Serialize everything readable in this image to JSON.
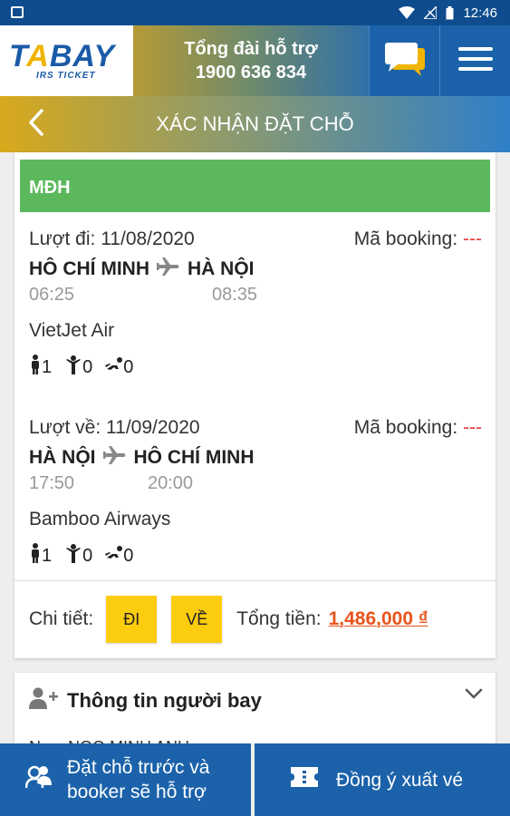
{
  "status_bar": {
    "time": "12:46"
  },
  "header": {
    "logo_main_left": "T",
    "logo_main_a": "A",
    "logo_main_right": "BAY",
    "logo_sub": "IRS TICKET",
    "hotline_label": "Tổng đài hỗ trợ",
    "hotline_number": "1900 636 834"
  },
  "nav": {
    "title": "XÁC NHẬN ĐẶT CHỖ"
  },
  "booking": {
    "header": "MĐH",
    "outbound": {
      "label": "Lượt đi: 11/08/2020",
      "booking_label": "Mã booking:",
      "booking_value": "---",
      "from": "HÔ CHÍ MINH",
      "to": "HÀ NỘI",
      "depart_time": "06:25",
      "arrive_time": "08:35",
      "airline": "VietJet Air",
      "adults": "1",
      "children": "0",
      "infants": "0"
    },
    "return": {
      "label": "Lượt về: 11/09/2020",
      "booking_label": "Mã booking:",
      "booking_value": "---",
      "from": "HÀ NỘI",
      "to": "HÔ CHÍ MINH",
      "depart_time": "17:50",
      "arrive_time": "20:00",
      "airline": "Bamboo Airways",
      "adults": "1",
      "children": "0",
      "infants": "0"
    },
    "detail_label": "Chi tiết:",
    "btn_outbound": "ĐI",
    "btn_return": "VỀ",
    "total_label": "Tổng tiền:",
    "total_value": "1,486,000 ₫"
  },
  "passenger": {
    "title": "Thông tin người bay",
    "peek": "Nam  NGO MINH ANH"
  },
  "bottom": {
    "reserve_line1": "Đặt chỗ trước và",
    "reserve_line2": "booker sẽ hỗ trợ",
    "issue_label": "Đồng ý xuất vé"
  },
  "colors": {
    "primary": "#1b62aa",
    "green": "#5cb85c",
    "yellow": "#fccc0e",
    "price": "#e8541c"
  }
}
